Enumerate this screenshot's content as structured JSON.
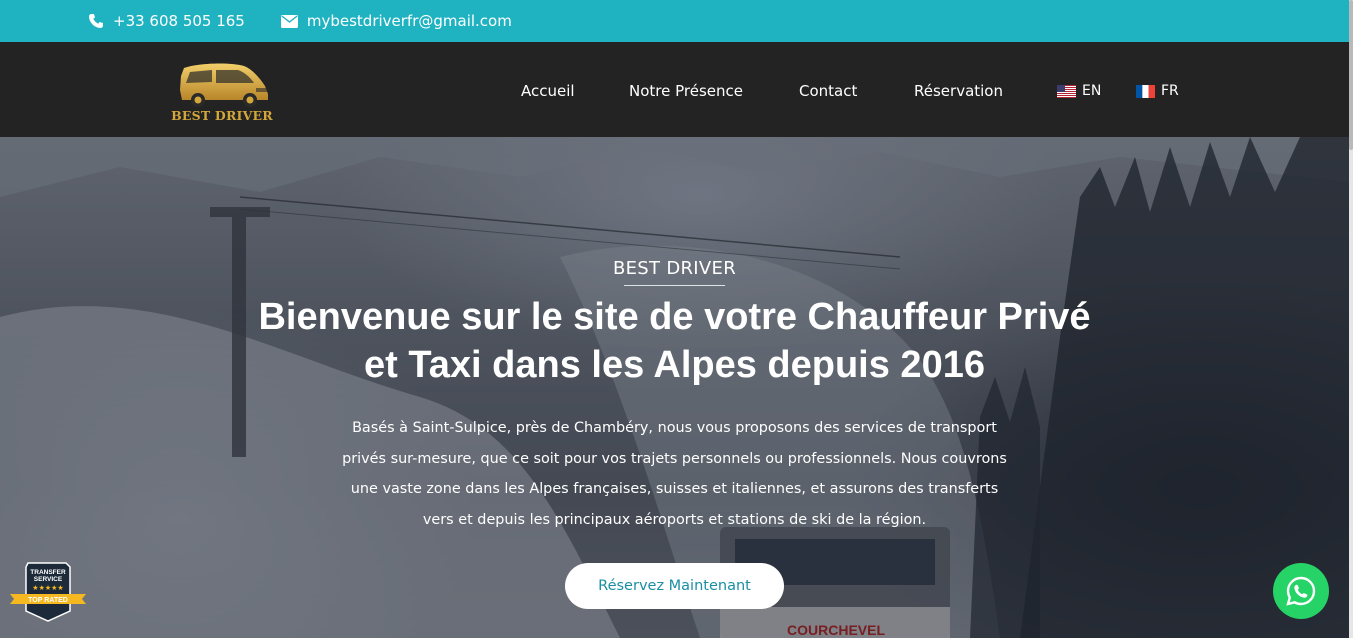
{
  "topbar": {
    "phone": "+33 608 505 165",
    "email": "mybestdriverfr@gmail.com",
    "phone_icon": "phone-icon",
    "email_icon": "envelope-icon"
  },
  "logo": {
    "text": "BEST DRIVER"
  },
  "nav": {
    "items": [
      {
        "label": "Accueil"
      },
      {
        "label": "Notre Présence"
      },
      {
        "label": "Contact"
      },
      {
        "label": "Réservation"
      }
    ],
    "languages": [
      {
        "label": "EN",
        "flag": "us-flag-icon"
      },
      {
        "label": "FR",
        "flag": "fr-flag-icon"
      }
    ]
  },
  "hero": {
    "eyebrow": "BEST DRIVER",
    "headline_line1": "Bienvenue sur le site de votre Chauffeur Privé",
    "headline_line2": "et Taxi dans les Alpes depuis 2016",
    "intro_lines": [
      "Basés à Saint-Sulpice, près de Chambéry, nous vous proposons des services de transport",
      "privés sur-mesure, que ce soit pour vos trajets personnels ou professionnels. Nous couvrons",
      "une vaste zone dans les Alpes françaises, suisses et italiennes, et assurons des transferts",
      "vers et depuis les principaux aéroports et stations de ski de la région."
    ],
    "cta_label": "Réservez Maintenant",
    "gondola_sign": "COURCHEVEL"
  },
  "badge": {
    "line1": "TRANSFER",
    "line2": "SERVICE",
    "ribbon": "TOP RATED",
    "stars": "★★★★★"
  },
  "colors": {
    "topbar": "#1fb3c2",
    "header": "#232323",
    "logo_gold": "#d4a73a",
    "cta_text": "#1a8fa3",
    "whatsapp": "#25d366"
  }
}
